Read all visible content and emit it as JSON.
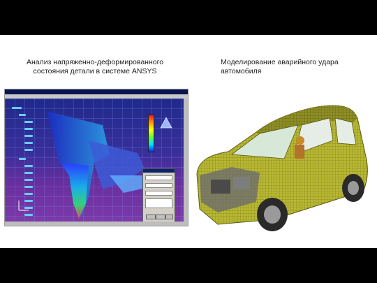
{
  "captions": {
    "left": "Анализ напряженно-деформированного состояния детали в системе ANSYS",
    "right": "Моделирование аварийного удара автомобиля"
  },
  "colors": {
    "background": "#000000",
    "slide": "#ffffff",
    "car_mesh": "#b8b832"
  },
  "images": {
    "left": "cad-fea-screenshot",
    "right": "crash-test-car-mesh"
  }
}
